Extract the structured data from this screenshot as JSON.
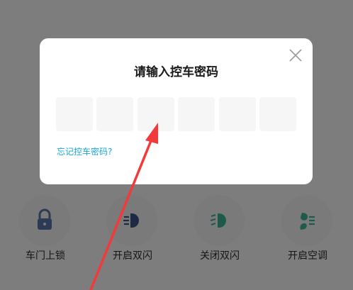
{
  "dialog": {
    "title": "请输入控车密码",
    "forgot_link": "忘记控车密码?",
    "close_icon": "close-icon",
    "pin_boxes": [
      "",
      "",
      "",
      "",
      "",
      ""
    ]
  },
  "controls": [
    {
      "label": "车门上锁",
      "icon": "lock-icon"
    },
    {
      "label": "开启双闪",
      "icon": "hazard-lights-on-icon"
    },
    {
      "label": "关闭双闪",
      "icon": "hazard-lights-off-icon"
    },
    {
      "label": "开启空调",
      "icon": "air-conditioner-icon"
    }
  ],
  "colors": {
    "overlay": "#7d7d7d",
    "link": "#1aa6d6",
    "annotation_arrow": "#f23a3a"
  }
}
